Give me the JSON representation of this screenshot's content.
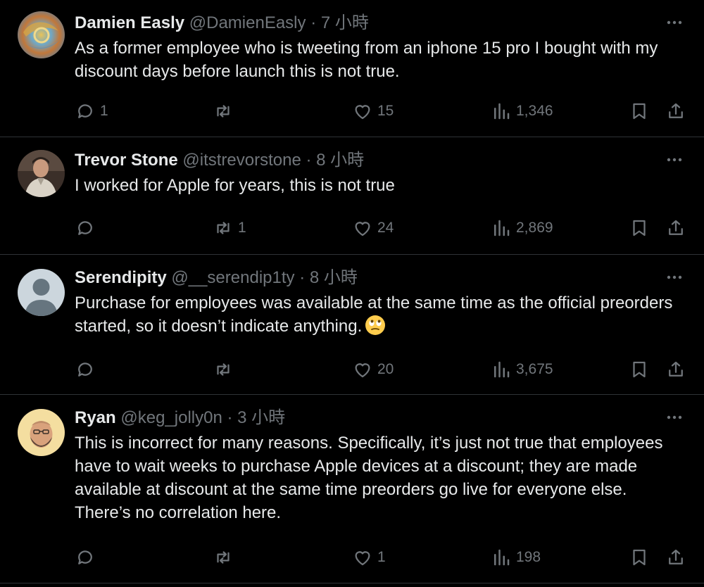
{
  "tweets": [
    {
      "name": "Damien Easly",
      "handle": "@DamienEasly",
      "sep": "·",
      "time": "7 小時",
      "text": "As a former employee who is tweeting from an iphone 15 pro I bought with my discount days before launch this is not true.",
      "emoji": "",
      "replies": "1",
      "retweets": "",
      "likes": "15",
      "views": "1,346"
    },
    {
      "name": "Trevor Stone",
      "handle": "@itstrevorstone",
      "sep": "·",
      "time": "8 小時",
      "text": "I worked for Apple for years, this is not true",
      "emoji": "",
      "replies": "",
      "retweets": "1",
      "likes": "24",
      "views": "2,869"
    },
    {
      "name": "Serendipity",
      "handle": "@__serendip1ty",
      "sep": "·",
      "time": "8 小時",
      "text": "Purchase for employees was available at the same time as the official preorders started, so it doesn’t indicate anything.",
      "emoji": "face-with-rolling-eyes",
      "replies": "",
      "retweets": "",
      "likes": "20",
      "views": "3,675"
    },
    {
      "name": "Ryan",
      "handle": "@keg_jolly0n",
      "sep": "·",
      "time": "3 小時",
      "text": "This is incorrect for many reasons. Specifically, it’s just not true that employees have to wait weeks to purchase Apple devices at a discount; they are made available at discount at the same time preorders go live for everyone else. There’s no correlation here.",
      "emoji": "",
      "replies": "",
      "retweets": "",
      "likes": "1",
      "views": "198"
    }
  ],
  "colors": {
    "background": "#000000",
    "text": "#e7e9ea",
    "muted": "#71767b",
    "divider": "#2f3336"
  }
}
